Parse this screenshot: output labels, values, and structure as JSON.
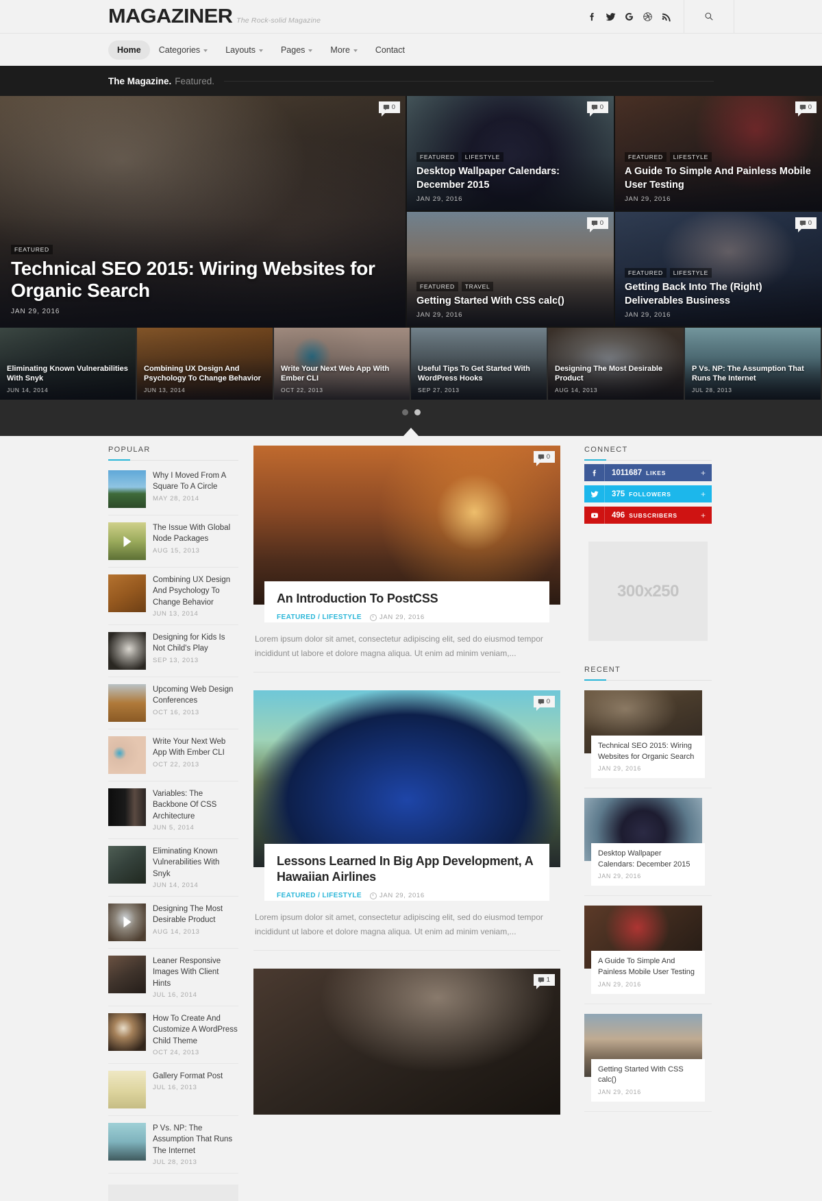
{
  "header": {
    "logo": "MAGAZINER",
    "tagline": "The Rock-solid Magazine",
    "social": [
      {
        "name": "facebook-icon",
        "label": "Facebook"
      },
      {
        "name": "twitter-icon",
        "label": "Twitter"
      },
      {
        "name": "google-plus-icon",
        "label": "Google Plus"
      },
      {
        "name": "dribbble-icon",
        "label": "Dribbble"
      },
      {
        "name": "rss-icon",
        "label": "RSS"
      }
    ],
    "search_icon": "search-icon"
  },
  "nav": [
    {
      "label": "Home",
      "active": true,
      "dropdown": false
    },
    {
      "label": "Categories",
      "active": false,
      "dropdown": true
    },
    {
      "label": "Layouts",
      "active": false,
      "dropdown": true
    },
    {
      "label": "Pages",
      "active": false,
      "dropdown": true
    },
    {
      "label": "More",
      "active": false,
      "dropdown": true
    },
    {
      "label": "Contact",
      "active": false,
      "dropdown": false
    }
  ],
  "featured_bar": {
    "strong": "The Magazine.",
    "light": "Featured."
  },
  "hero": {
    "main": {
      "categories": [
        "FEATURED"
      ],
      "title": "Technical SEO 2015: Wiring Websites for Organic Search",
      "date": "JAN 29, 2016",
      "comments": "0"
    },
    "tiles": [
      {
        "categories": [
          "FEATURED",
          "LIFESTYLE"
        ],
        "title": "Desktop Wallpaper Calendars: December 2015",
        "date": "JAN 29, 2016",
        "comments": "0"
      },
      {
        "categories": [
          "FEATURED",
          "LIFESTYLE"
        ],
        "title": "A Guide To Simple And Painless Mobile User Testing",
        "date": "JAN 29, 2016",
        "comments": "0"
      },
      {
        "categories": [
          "FEATURED",
          "TRAVEL"
        ],
        "title": "Getting Started With CSS calc()",
        "date": "JAN 29, 2016",
        "comments": "0"
      },
      {
        "categories": [
          "FEATURED",
          "LIFESTYLE"
        ],
        "title": "Getting Back Into The (Right) Deliverables Business",
        "date": "JAN 29, 2016",
        "comments": "0"
      }
    ]
  },
  "strip": [
    {
      "title": "Eliminating Known Vulnerabilities With Snyk",
      "date": "JUN 14, 2014"
    },
    {
      "title": "Combining UX Design And Psychology To Change Behavior",
      "date": "JUN 13, 2014"
    },
    {
      "title": "Write Your Next Web App With Ember CLI",
      "date": "OCT 22, 2013"
    },
    {
      "title": "Useful Tips To Get Started With WordPress Hooks",
      "date": "SEP 27, 2013"
    },
    {
      "title": "Designing The Most Desirable Product",
      "date": "AUG 14, 2013"
    },
    {
      "title": "P Vs. NP: The Assumption That Runs The Internet",
      "date": "JUL 28, 2013"
    }
  ],
  "carousel": {
    "dots": 2,
    "active_index": 1
  },
  "popular": {
    "title": "POPULAR",
    "items": [
      {
        "title": "Why I Moved From A Square To A Circle",
        "date": "MAY 28, 2014",
        "video": false
      },
      {
        "title": "The Issue With Global Node Packages",
        "date": "AUG 15, 2013",
        "video": true
      },
      {
        "title": "Combining UX Design And Psychology To Change Behavior",
        "date": "JUN 13, 2014",
        "video": false
      },
      {
        "title": "Designing for Kids Is Not Child's Play",
        "date": "SEP 13, 2013",
        "video": false
      },
      {
        "title": "Upcoming Web Design Conferences",
        "date": "OCT 16, 2013",
        "video": false
      },
      {
        "title": "Write Your Next Web App With Ember CLI",
        "date": "OCT 22, 2013",
        "video": false
      },
      {
        "title": "Variables: The Backbone Of CSS Architecture",
        "date": "JUN 5, 2014",
        "video": false
      },
      {
        "title": "Eliminating Known Vulnerabilities With Snyk",
        "date": "JUN 14, 2014",
        "video": false
      },
      {
        "title": "Designing The Most Desirable Product",
        "date": "AUG 14, 2013",
        "video": true
      },
      {
        "title": "Leaner Responsive Images With Client Hints",
        "date": "JUL 16, 2014",
        "video": false
      },
      {
        "title": "How To Create And Customize A WordPress Child Theme",
        "date": "OCT 24, 2013",
        "video": false
      },
      {
        "title": "Gallery Format Post",
        "date": "JUL 16, 2013",
        "video": false
      },
      {
        "title": "P Vs. NP: The Assumption That Runs The Internet",
        "date": "JUL 28, 2013",
        "video": false
      }
    ]
  },
  "articles": [
    {
      "title": "An Introduction To PostCSS",
      "categories": "FEATURED / LIFESTYLE",
      "date": "JAN 29, 2016",
      "comments": "0",
      "excerpt": "Lorem ipsum dolor sit amet, consectetur adipiscing elit, sed do eiusmod tempor incididunt ut labore et dolore magna aliqua. Ut enim ad minim veniam,..."
    },
    {
      "title": "Lessons Learned In Big App Development, A Hawaiian Airlines",
      "categories": "FEATURED / LIFESTYLE",
      "date": "JAN 29, 2016",
      "comments": "0",
      "excerpt": "Lorem ipsum dolor sit amet, consectetur adipiscing elit, sed do eiusmod tempor incididunt ut labore et dolore magna aliqua. Ut enim ad minim veniam,..."
    },
    {
      "title": "",
      "categories": "",
      "date": "",
      "comments": "1",
      "excerpt": ""
    }
  ],
  "connect": {
    "title": "CONNECT",
    "items": [
      {
        "network": "facebook-icon",
        "count": "1011687",
        "label": "LIKES",
        "color": "#3d5a98",
        "plus": "+"
      },
      {
        "network": "twitter-icon",
        "count": "375",
        "label": "FOLLOWERS",
        "color": "#1cb7eb",
        "plus": "+"
      },
      {
        "network": "youtube-icon",
        "count": "496",
        "label": "SUBSCRIBERS",
        "color": "#cf1312",
        "plus": "+"
      }
    ]
  },
  "ad": {
    "label": "300x250"
  },
  "recent": {
    "title": "RECENT",
    "items": [
      {
        "title": "Technical SEO 2015: Wiring Websites for Organic Search",
        "date": "JAN 29, 2016"
      },
      {
        "title": "Desktop Wallpaper Calendars: December 2015",
        "date": "JAN 29, 2016"
      },
      {
        "title": "A Guide To Simple And Painless Mobile User Testing",
        "date": "JAN 29, 2016"
      },
      {
        "title": "Getting Started With CSS calc()",
        "date": "JAN 29, 2016"
      }
    ]
  },
  "theme": {
    "accent": "#29b6d8",
    "dark": "#1c1c1c",
    "page_bg": "#f2f2f2"
  }
}
